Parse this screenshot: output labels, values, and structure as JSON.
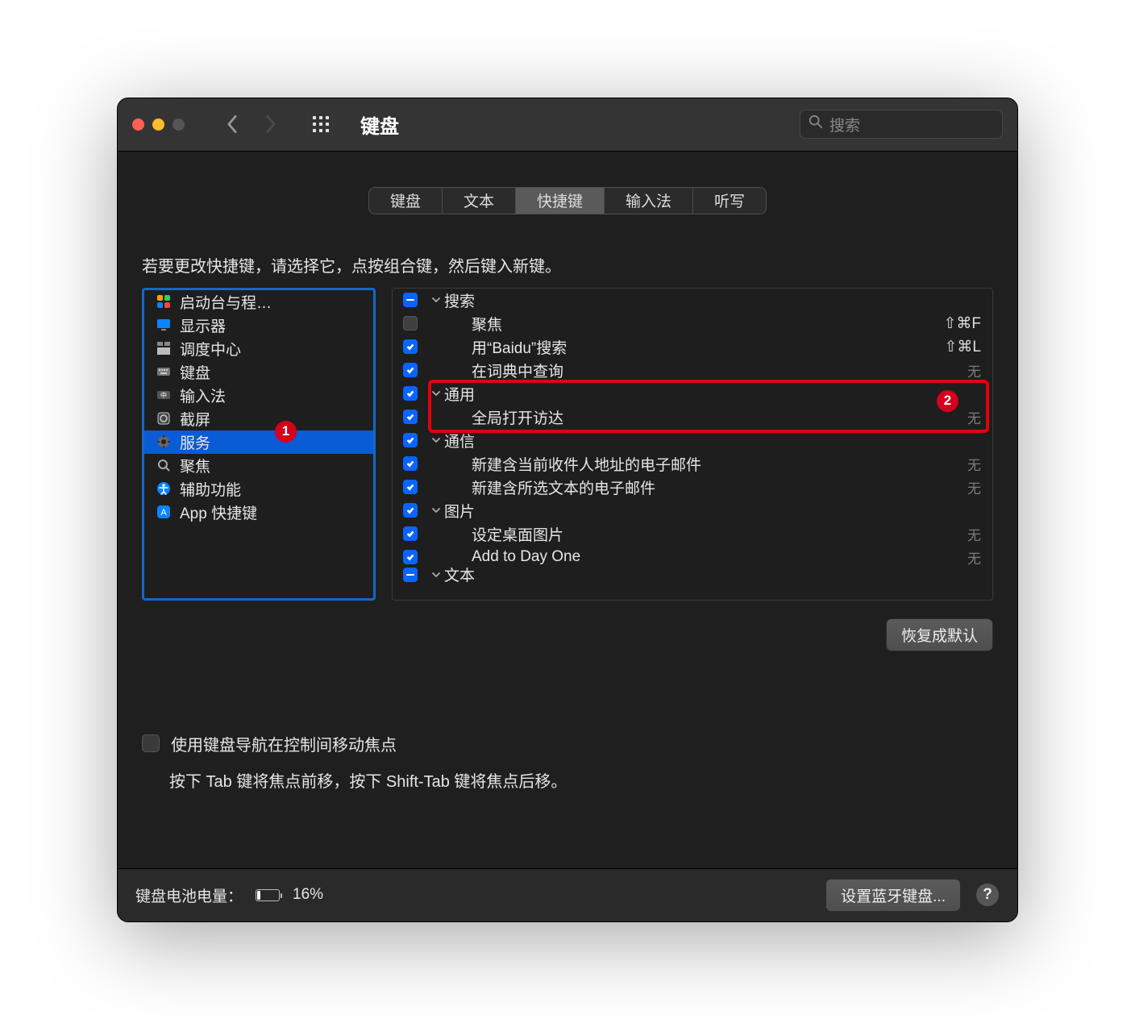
{
  "titlebar": {
    "title": "键盘",
    "search_placeholder": "搜索"
  },
  "tabs": [
    "键盘",
    "文本",
    "快捷键",
    "输入法",
    "听写"
  ],
  "active_tab_index": 2,
  "instructions": "若要更改快捷键，请选择它，点按组合键，然后键入新键。",
  "categories": [
    {
      "label": "启动台与程…",
      "icon": "launchpad"
    },
    {
      "label": "显示器",
      "icon": "display"
    },
    {
      "label": "调度中心",
      "icon": "mission"
    },
    {
      "label": "键盘",
      "icon": "keyboard"
    },
    {
      "label": "输入法",
      "icon": "input"
    },
    {
      "label": "截屏",
      "icon": "screenshot"
    },
    {
      "label": "服务",
      "icon": "gear",
      "selected": true
    },
    {
      "label": "聚焦",
      "icon": "spotlight"
    },
    {
      "label": "辅助功能",
      "icon": "accessibility"
    },
    {
      "label": "App 快捷键",
      "icon": "appstore"
    }
  ],
  "services": [
    {
      "type": "header",
      "label": "搜索",
      "check": "mixed"
    },
    {
      "type": "child",
      "label": "聚焦",
      "check": "off",
      "shortcut": "⇧⌘F"
    },
    {
      "type": "child",
      "label": "用“Baidu”搜索",
      "check": "on",
      "shortcut": "⇧⌘L"
    },
    {
      "type": "child",
      "label": "在词典中查询",
      "check": "on",
      "shortcut": "无"
    },
    {
      "type": "header",
      "label": "通用",
      "check": "on"
    },
    {
      "type": "child",
      "label": "全局打开访达",
      "check": "on",
      "shortcut": "无"
    },
    {
      "type": "header",
      "label": "通信",
      "check": "on"
    },
    {
      "type": "child",
      "label": "新建含当前收件人地址的电子邮件",
      "check": "on",
      "shortcut": "无"
    },
    {
      "type": "child",
      "label": "新建含所选文本的电子邮件",
      "check": "on",
      "shortcut": "无"
    },
    {
      "type": "header",
      "label": "图片",
      "check": "on"
    },
    {
      "type": "child",
      "label": "设定桌面图片",
      "check": "on",
      "shortcut": "无"
    },
    {
      "type": "child",
      "label": "Add to Day One",
      "check": "on",
      "shortcut": "无"
    },
    {
      "type": "header",
      "label": "文本",
      "check": "mixed",
      "cutoff": true
    }
  ],
  "restore_default": "恢复成默认",
  "keyboard_nav_label": "使用键盘导航在控制间移动焦点",
  "keyboard_nav_sub": "按下 Tab 键将焦点前移，按下 Shift-Tab 键将焦点后移。",
  "footer": {
    "battery_label": "键盘电池电量：",
    "battery_pct": "16%",
    "bluetooth_button": "设置蓝牙键盘...",
    "help": "?"
  },
  "callouts": {
    "one": "1",
    "two": "2"
  },
  "none_label": "无"
}
